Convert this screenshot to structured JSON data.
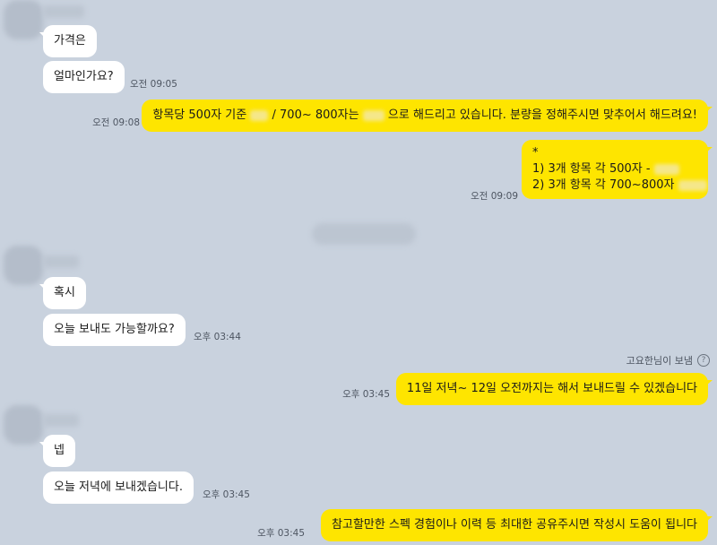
{
  "colors": {
    "background": "#c9d2de",
    "incoming_bubble": "#ffffff",
    "outgoing_bubble": "#fee500"
  },
  "messages": [
    {
      "side": "in",
      "text": "가격은",
      "time": ""
    },
    {
      "side": "in",
      "text": "얼마인가요?",
      "time": "오전 09:05"
    },
    {
      "side": "out",
      "text_a": "항목당 500자 기준",
      "text_b": "/ 700~ 800자는",
      "text_c": "으로 해드리고 있습니다. 분량을 정해주시면 맞추어서 해드려요!",
      "time": "오전 09:08"
    },
    {
      "side": "out",
      "line0": "*",
      "line1": "1) 3개 항목 각 500자 -",
      "line2": "2) 3개 항목 각 700~800자",
      "time": "오전 09:09"
    },
    {
      "side": "in",
      "text": "혹시",
      "time": ""
    },
    {
      "side": "in",
      "text": "오늘 보내도 가능할까요?",
      "time": "오후 03:44"
    },
    {
      "side": "out",
      "text": "11일 저녁~ 12일 오전까지는 해서 보내드릴 수 있겠습니다",
      "time": "오후 03:45"
    },
    {
      "side": "in",
      "text": "넵",
      "time": ""
    },
    {
      "side": "in",
      "text": "오늘 저녁에 보내겠습니다.",
      "time": "오후 03:45"
    },
    {
      "side": "out",
      "text": "참고할만한 스펙 경험이나 이력 등 최대한 공유주시면 작성시 도움이 됩니다",
      "time": "오후 03:45"
    }
  ],
  "read_status": {
    "label": "고요한님이 보냄",
    "icon": "help-circle-icon",
    "icon_glyph": "?"
  }
}
